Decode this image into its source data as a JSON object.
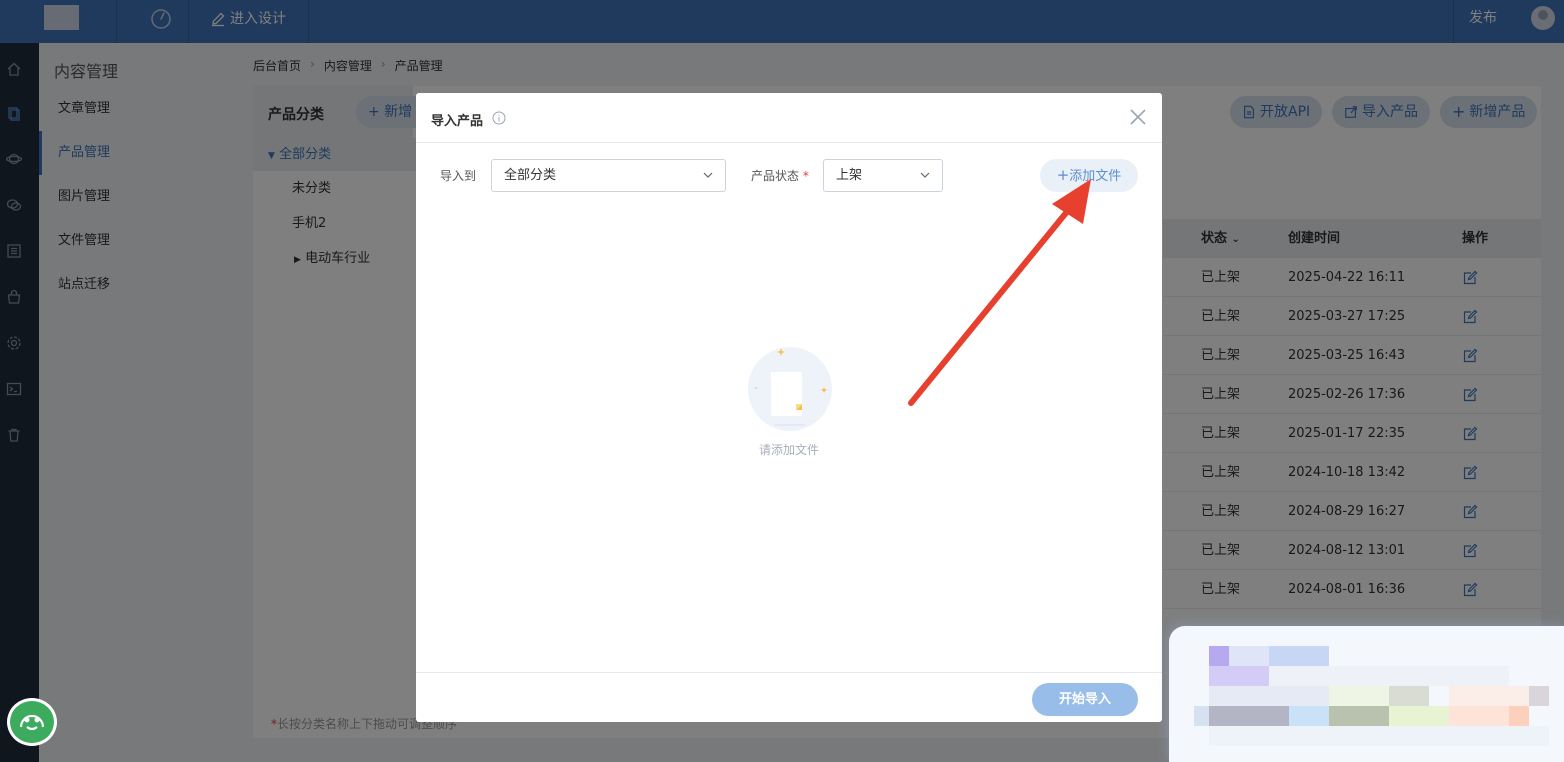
{
  "topbar": {
    "design_label": "进入设计",
    "publish_label": "发布"
  },
  "sidebar": {
    "title": "内容管理",
    "items": [
      "文章管理",
      "产品管理",
      "图片管理",
      "文件管理",
      "站点迁移"
    ],
    "active_index": 1
  },
  "breadcrumb": [
    "后台首页",
    "内容管理",
    "产品管理"
  ],
  "category": {
    "title": "产品分类",
    "add_label": "新增",
    "items": [
      "全部分类",
      "未分类",
      "手机2",
      "电动车行业"
    ],
    "note": "长按分类名称上下拖动可调整顺序"
  },
  "toolbar": {
    "open_api": "开放API",
    "import_products": "导入产品",
    "new_product": "新增产品"
  },
  "table": {
    "headers": [
      "状态",
      "创建时间",
      "操作"
    ],
    "rows": [
      {
        "status": "已上架",
        "created": "2025-04-22 16:11"
      },
      {
        "status": "已上架",
        "created": "2025-03-27 17:25"
      },
      {
        "status": "已上架",
        "created": "2025-03-25 16:43"
      },
      {
        "status": "已上架",
        "created": "2025-02-26 17:36"
      },
      {
        "status": "已上架",
        "created": "2025-01-17 22:35"
      },
      {
        "status": "已上架",
        "created": "2024-10-18 13:42"
      },
      {
        "status": "已上架",
        "created": "2024-08-29 16:27"
      },
      {
        "status": "已上架",
        "created": "2024-08-12 13:01"
      },
      {
        "status": "已上架",
        "created": "2024-08-01 16:36"
      }
    ]
  },
  "modal": {
    "title": "导入产品",
    "import_to_label": "导入到",
    "import_to_value": "全部分类",
    "status_label": "产品状态",
    "required_mark": "*",
    "status_value": "上架",
    "add_file_label": "添加文件",
    "empty_text": "请添加文件",
    "start_label": "开始导入"
  },
  "colors": {
    "topbar": "#3e74b8",
    "rail": "#1f2d3d",
    "accent": "#3e74b8",
    "arrow": "#e8402e",
    "start_button": "#98bde8"
  }
}
